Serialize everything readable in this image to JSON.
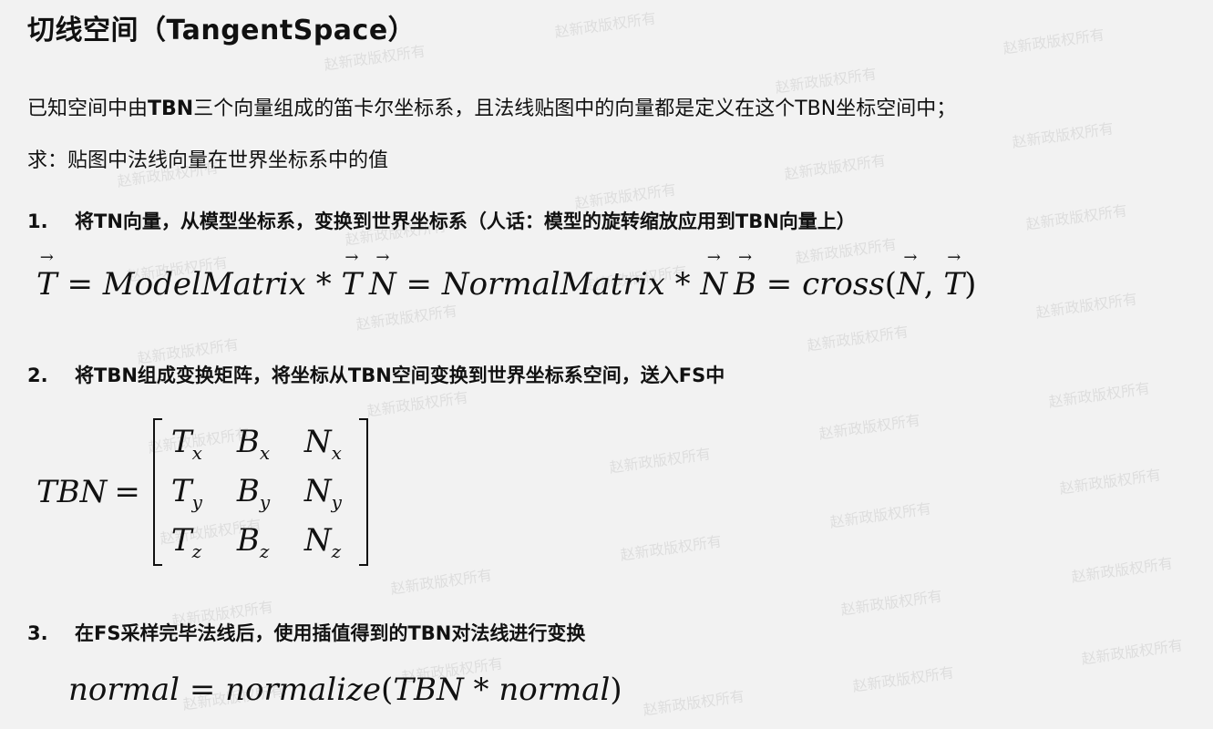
{
  "title": "切线空间（TangentSpace）",
  "intro": {
    "line1_pre": "已知空间中由",
    "line1_bold": "TBN",
    "line1_post": "三个向量组成的笛卡尔坐标系，且法线贴图中的向量都是定义在这个TBN坐标空间中；",
    "line2": "求：贴图中法线向量在世界坐标系中的值"
  },
  "steps": [
    {
      "num": "1.",
      "text": "将TN向量，从模型坐标系，变换到世界坐标系（人话：模型的旋转缩放应用到TBN向量上）"
    },
    {
      "num": "2.",
      "text": "将TBN组成变换矩阵，将坐标从TBN空间变换到世界坐标系空间，送入FS中"
    },
    {
      "num": "3.",
      "text": "在FS采样完毕法线后，使用插值得到的TBN对法线进行变换"
    }
  ],
  "equations": {
    "t_lhs": "T",
    "t_rhs": "ModelMatrix",
    "t_vec": "T",
    "n_lhs": "N",
    "n_rhs": "NormalMatrix",
    "n_vec": "N",
    "b_lhs": "B",
    "b_func": "cross",
    "b_arg1": "N",
    "b_arg2": "T",
    "tbn_label": "TBN",
    "matrix": [
      [
        "T",
        "x",
        "B",
        "x",
        "N",
        "x"
      ],
      [
        "T",
        "y",
        "B",
        "y",
        "N",
        "y"
      ],
      [
        "T",
        "z",
        "B",
        "z",
        "N",
        "z"
      ]
    ],
    "final_lhs": "normal",
    "final_func": "normalize",
    "final_arg1": "TBN",
    "final_arg2": "normal"
  },
  "watermark": "赵新政版权所有"
}
